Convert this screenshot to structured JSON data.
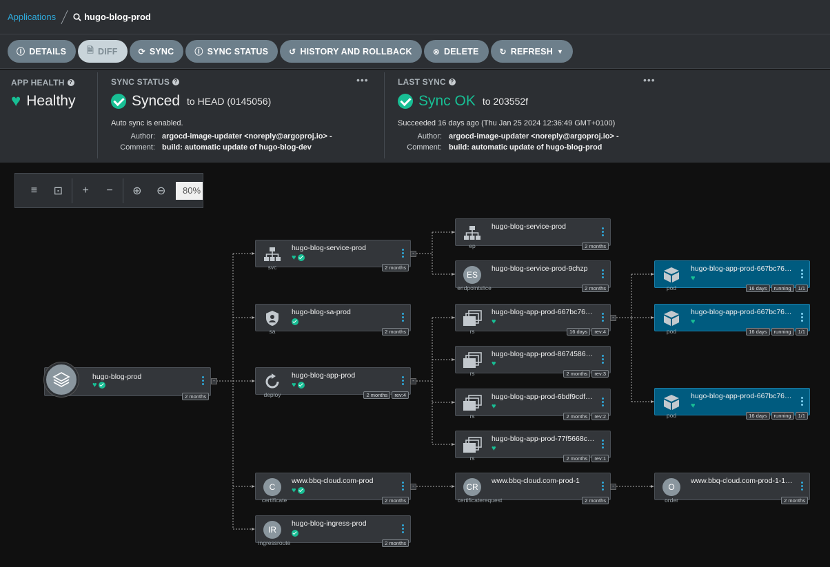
{
  "breadcrumb": {
    "root": "Applications",
    "current": "hugo-blog-prod"
  },
  "toolbar": {
    "details": "DETAILS",
    "diff": "DIFF",
    "sync": "SYNC",
    "sync_status": "SYNC STATUS",
    "history": "HISTORY AND ROLLBACK",
    "delete": "DELETE",
    "refresh": "REFRESH"
  },
  "app_health": {
    "label": "APP HEALTH",
    "value": "Healthy"
  },
  "sync_status": {
    "label": "SYNC STATUS",
    "value": "Synced",
    "to": "to HEAD (0145056)",
    "auto": "Auto sync is enabled.",
    "author_k": "Author:",
    "author": "argocd-image-updater <noreply@argoproj.io> -",
    "comment_k": "Comment:",
    "comment": "build: automatic update of hugo-blog-dev"
  },
  "last_sync": {
    "label": "LAST SYNC",
    "value": "Sync OK",
    "to": "to 203552f",
    "succeeded": "Succeeded 16 days ago (Thu Jan 25 2024 12:36:49 GMT+0100)",
    "author_k": "Author:",
    "author": "argocd-image-updater <noreply@argoproj.io> -",
    "comment_k": "Comment:",
    "comment": "build: automatic update of hugo-blog-prod"
  },
  "zoom": {
    "value": "80%"
  },
  "app_node": {
    "name": "hugo-blog-prod",
    "age": "2 months"
  },
  "nodes": [
    {
      "name": "hugo-blog-service-prod",
      "kind": "svc",
      "age": "2 months"
    },
    {
      "name": "hugo-blog-sa-prod",
      "kind": "sa",
      "age": "2 months"
    },
    {
      "name": "hugo-blog-app-prod",
      "kind": "deploy",
      "age": "2 months",
      "rev": "rev:4"
    },
    {
      "name": "www.bbq-cloud.com-prod",
      "kind": "certificate",
      "age": "2 months",
      "badge": "C"
    },
    {
      "name": "hugo-blog-ingress-prod",
      "kind": "ingressroute",
      "age": "2 months",
      "badge": "IR"
    },
    {
      "name": "hugo-blog-service-prod",
      "kind": "ep",
      "age": "2 months"
    },
    {
      "name": "hugo-blog-service-prod-9chzp",
      "kind": "endpointslice",
      "age": "2 months",
      "badge": "ES"
    },
    {
      "name": "hugo-blog-app-prod-667bc76…",
      "kind": "rs",
      "age": "16 days",
      "rev": "rev:4"
    },
    {
      "name": "hugo-blog-app-prod-8674586…",
      "kind": "rs",
      "age": "2 months",
      "rev": "rev:3"
    },
    {
      "name": "hugo-blog-app-prod-6bdf9cdf…",
      "kind": "rs",
      "age": "2 months",
      "rev": "rev:2"
    },
    {
      "name": "hugo-blog-app-prod-77f5668c…",
      "kind": "rs",
      "age": "2 months",
      "rev": "rev:1"
    },
    {
      "name": "www.bbq-cloud.com-prod-1",
      "kind": "certificaterequest",
      "age": "2 months",
      "badge": "CR"
    },
    {
      "name": "hugo-blog-app-prod-667bc76…",
      "kind": "pod",
      "age": "16 days",
      "state": "running",
      "ready": "1/1"
    },
    {
      "name": "hugo-blog-app-prod-667bc76…",
      "kind": "pod",
      "age": "16 days",
      "state": "running",
      "ready": "1/1"
    },
    {
      "name": "hugo-blog-app-prod-667bc76…",
      "kind": "pod",
      "age": "16 days",
      "state": "running",
      "ready": "1/1"
    },
    {
      "name": "www.bbq-cloud.com-prod-1-1…",
      "kind": "order",
      "age": "2 months",
      "badge": "O"
    }
  ],
  "colors": {
    "accent": "#2fa8d8",
    "healthy": "#18be94",
    "pod_bg": "#005b7f"
  }
}
